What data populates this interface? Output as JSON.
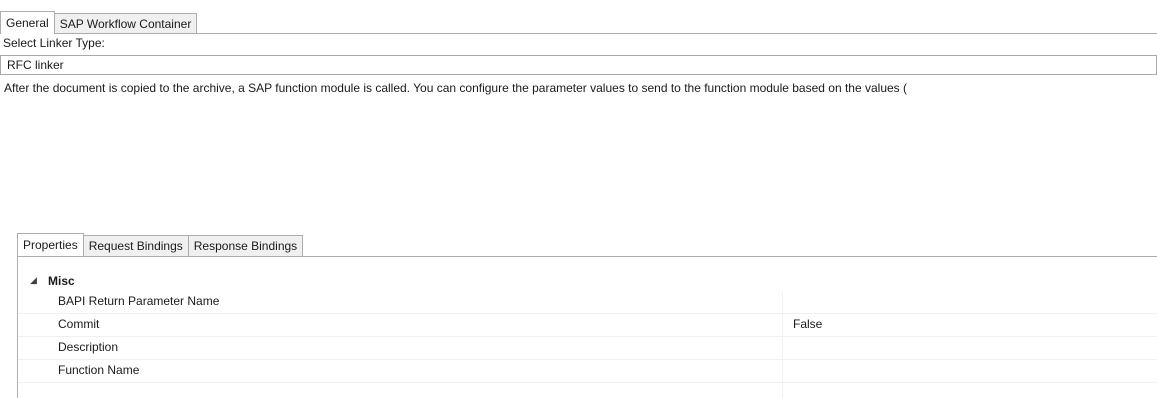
{
  "top_tabs": [
    {
      "label": "General",
      "active": true
    },
    {
      "label": "SAP Workflow Container",
      "active": false
    }
  ],
  "linker": {
    "label": "Select Linker Type:",
    "value": "RFC linker"
  },
  "description": "After the document is copied to the archive, a SAP function module is called. You can configure the parameter values to send to the function module based on the values (",
  "inner_tabs": [
    {
      "label": "Properties",
      "active": true
    },
    {
      "label": "Request Bindings",
      "active": false
    },
    {
      "label": "Response Bindings",
      "active": false
    }
  ],
  "property_grid": {
    "category": {
      "label": "Misc",
      "expander": "◢"
    },
    "rows": [
      {
        "name": "BAPI Return Parameter Name",
        "value": ""
      },
      {
        "name": "Commit",
        "value": "False"
      },
      {
        "name": "Description",
        "value": ""
      },
      {
        "name": "Function Name",
        "value": ""
      }
    ]
  }
}
